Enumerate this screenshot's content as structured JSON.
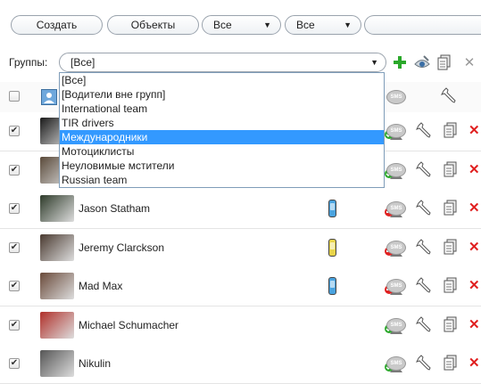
{
  "toolbar": {
    "create_label": "Создать",
    "objects_label": "Объекты",
    "filter1_value": "Все",
    "filter2_value": "Все",
    "search_value": ""
  },
  "groups": {
    "label": "Группы:",
    "selected": "[Все]",
    "options": [
      "[Все]",
      "[Водители вне групп]",
      "International team",
      "TIR drivers",
      "Международники",
      "Мотоциклисты",
      "Неуловимые мстители",
      "Russian team"
    ],
    "highlighted_index": 4
  },
  "header": {
    "sms_label": "SMS"
  },
  "drivers": [
    {
      "name": "",
      "checked": true,
      "phone": "",
      "driver_status": "online"
    },
    {
      "name": "",
      "checked": true,
      "phone": "",
      "driver_status": "online"
    },
    {
      "name": "Jason Statham",
      "checked": true,
      "phone": "blue",
      "driver_status": "offline"
    },
    {
      "name": "Jeremy Clarckson",
      "checked": true,
      "phone": "yellow",
      "driver_status": "offline"
    },
    {
      "name": "Mad Max",
      "checked": true,
      "phone": "blue",
      "driver_status": "offline"
    },
    {
      "name": "Michael Schumacher",
      "checked": true,
      "phone": "",
      "driver_status": "online"
    },
    {
      "name": "Nikulin",
      "checked": true,
      "phone": "",
      "driver_status": "online"
    }
  ],
  "colors": {
    "accent_green": "#2aa82a",
    "delete_red": "#e02020",
    "highlight_blue": "#3399ff",
    "phone_blue": "#4aa3df",
    "phone_yellow": "#e8d44a"
  },
  "icons": {
    "add": "plus-icon",
    "visibility": "eye-icon",
    "copy": "copy-icon",
    "close": "close-icon",
    "sms": "sms-icon",
    "settings": "wrench-icon",
    "document": "document-icon",
    "delete": "delete-icon",
    "driver": "driver-icon",
    "phone": "phone-icon"
  }
}
